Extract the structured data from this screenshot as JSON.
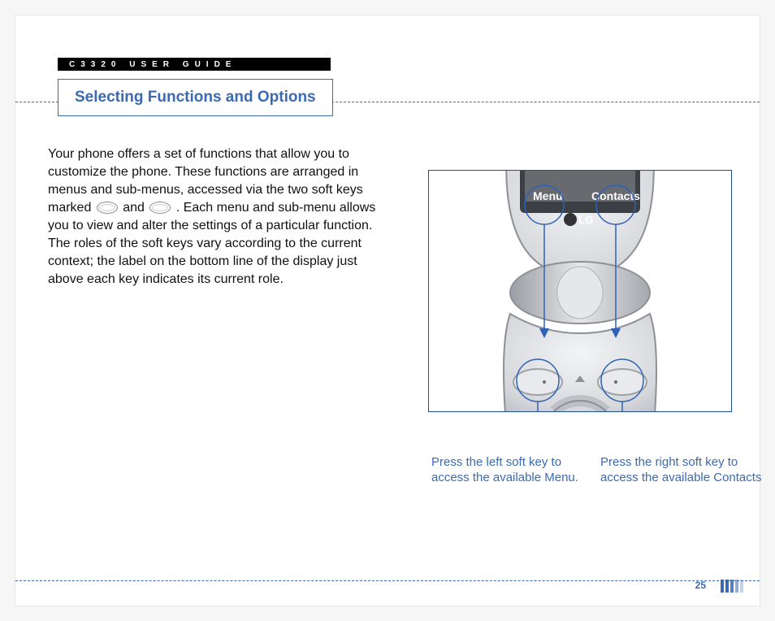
{
  "header": {
    "model_stripe": "C3320 USER GUIDE",
    "title": "Selecting Functions and Options"
  },
  "body": {
    "p1a": "Your phone offers a set of functions that allow you to customize the phone. These functions are arranged in menus and sub-menus, accessed via the two soft keys marked ",
    "p1b": " and ",
    "p1c": ". Each menu and sub-menu allows you to view and alter the settings of a particular function.",
    "p2": "The roles of the soft keys vary according to the current context; the label on the bottom line of the display just above each key indicates its current role."
  },
  "phone": {
    "brand": "LG",
    "screen_left_label": "Menu",
    "screen_right_label": "Contacts",
    "caption_left": "Press the left soft key to access the available Menu.",
    "caption_right": "Press the right soft key to access the available Contacts"
  },
  "page_number": "25"
}
